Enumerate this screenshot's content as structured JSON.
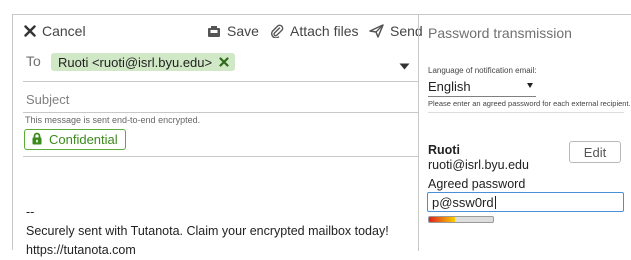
{
  "toolbar": {
    "cancel_label": "Cancel",
    "save_label": "Save",
    "attach_label": "Attach files",
    "send_label": "Send"
  },
  "recipients": {
    "to_label": "To",
    "chip_text": "Ruoti <ruoti@isrl.byu.edu>"
  },
  "subject": {
    "placeholder": "Subject"
  },
  "encryption": {
    "note": "This message is sent end-to-end encrypted.",
    "confidential_label": "Confidential"
  },
  "body": {
    "lines": [
      "--",
      "Securely sent with Tutanota. Claim your encrypted mailbox today!",
      "https://tutanota.com"
    ]
  },
  "panel": {
    "title": "Password transmission",
    "language_label": "Language of notification email:",
    "language_value": "English",
    "instruction": "Please enter an agreed password for each external recipient.",
    "recipient_name": "Ruoti",
    "recipient_email": "ruoti@isrl.byu.edu",
    "edit_label": "Edit",
    "agreed_label": "Agreed password",
    "password_value": "p@ssw0rd",
    "password_strength": 0.4
  },
  "colors": {
    "chip_bg": "#d0e8c5",
    "confidential": "#3a8a1c",
    "focus_border": "#4a90d9",
    "strength_low": "#e02020",
    "strength_mid": "#f7d000"
  }
}
